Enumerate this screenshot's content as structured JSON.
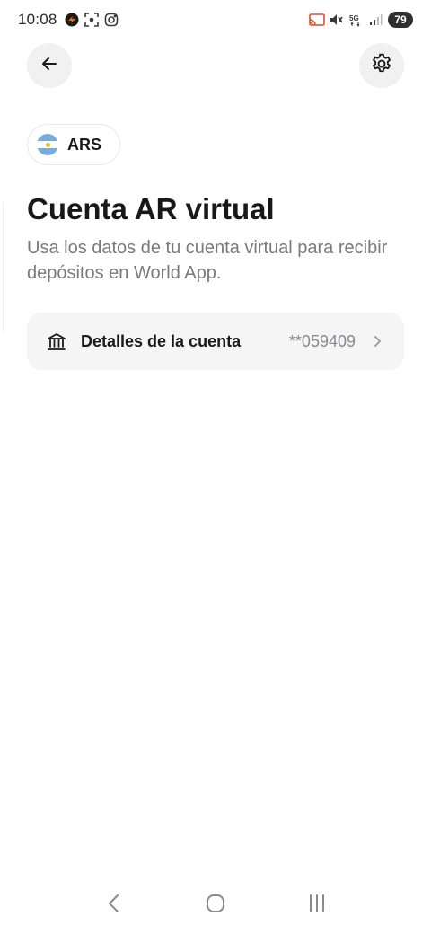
{
  "status_bar": {
    "time": "10:08",
    "battery": "79",
    "left_icons": [
      "app-notification-icon",
      "screenshot-icon",
      "instagram-icon"
    ],
    "right_icons": [
      "cast-icon",
      "mute-icon",
      "5g-icon",
      "signal-icon"
    ],
    "network_label": "5G"
  },
  "header": {
    "back_icon": "arrow-left-icon",
    "settings_icon": "gear-icon"
  },
  "currency": {
    "code": "ARS",
    "flag": "argentina-flag",
    "flag_colors": {
      "blue": "#74acdf",
      "white": "#ffffff",
      "sun": "#f6b40e"
    }
  },
  "main": {
    "title": "Cuenta AR virtual",
    "subtitle": "Usa los datos de tu cuenta virtual para recibir depósitos en World App."
  },
  "account": {
    "icon": "bank-icon",
    "label": "Detalles de la cuenta",
    "masked_number": "**059409",
    "chevron": "chevron-right-icon"
  },
  "nav_bar": {
    "back": "nav-back-icon",
    "home": "nav-home-icon",
    "recents": "nav-recents-icon"
  },
  "colors": {
    "background": "#ffffff",
    "circle_button": "#f1f1f2",
    "row_background": "#f5f5f6",
    "subtitle_text": "#7a7a7c",
    "muted_text": "#8a8a8d"
  }
}
